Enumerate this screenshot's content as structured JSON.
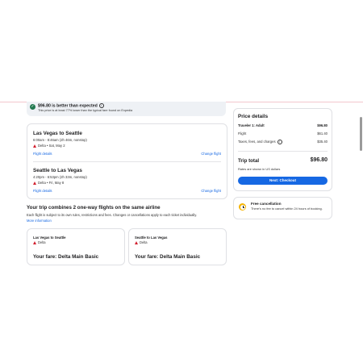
{
  "banner": {
    "title": "$96.80 is better than expected",
    "subtitle": "This price is at least 77% lower than the typical fare found on Expedia"
  },
  "flights": [
    {
      "route": "Las Vegas to Seattle",
      "times": "6:00am - 8:46am (2h 46m, nonstop)",
      "airline_date": "Delta • Sat, May 2",
      "details_link": "Flight details",
      "change_link": "Change flight"
    },
    {
      "route": "Seattle to Las Vegas",
      "times": "4:20pm - 6:53pm (2h 33m, nonstop)",
      "airline_date": "Delta • Fri, May 8",
      "details_link": "Flight details",
      "change_link": "Change flight"
    }
  ],
  "combo": {
    "title": "Your trip combines 2 one-way flights on the same airline",
    "subtitle": "Each flight is subject to its own rules, restrictions and fees. Changes or cancellations apply to each ticket individually.",
    "link": "More information"
  },
  "fares": [
    {
      "route": "Las Vegas to Seattle",
      "airline": "Delta",
      "title": "Your fare: Delta Main Basic"
    },
    {
      "route": "Seattle to Las Vegas",
      "airline": "Delta",
      "title": "Your fare: Delta Main Basic"
    }
  ],
  "price": {
    "title": "Price details",
    "rows": [
      {
        "label": "Traveler 1: Adult",
        "value": "$96.80"
      },
      {
        "label": "Flight",
        "value": "$61.40"
      },
      {
        "label": "Taxes, fees, and charges",
        "value": "$35.40"
      }
    ],
    "total_label": "Trip total",
    "total_value": "$96.80",
    "rates_note": "Rates are shown in US dollars",
    "checkout_label": "Next: Checkout"
  },
  "cancellation": {
    "title": "Free cancellation",
    "text": "There's no fee to cancel within 24 hours of booking."
  },
  "colors": {
    "accent": "#1668e3",
    "delta": "#d2202f",
    "good": "#227950",
    "clock": "#f5b400"
  },
  "icons": [
    "check-icon",
    "info-icon",
    "delta-logo-icon",
    "clock-icon"
  ]
}
